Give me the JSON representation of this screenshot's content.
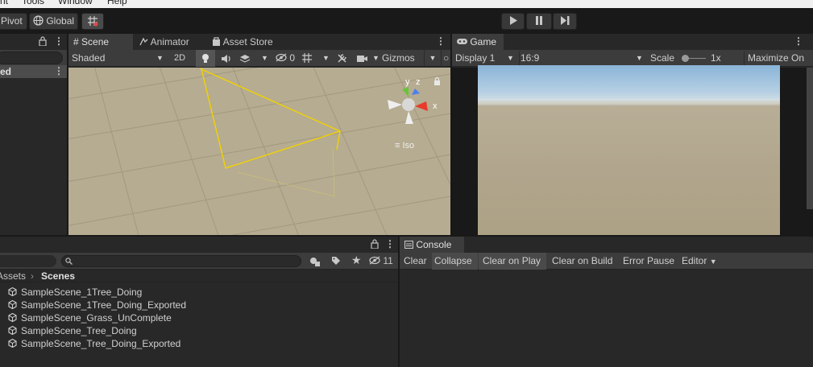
{
  "menu": {
    "items": [
      "nt",
      "Tools",
      "Window",
      "Help"
    ]
  },
  "toolbar": {
    "pivot_label": "Pivot",
    "global_label": "Global",
    "play_icon": "play-icon",
    "pause_icon": "pause-icon",
    "step_icon": "step-icon"
  },
  "hierarchy": {
    "row_label": "ed"
  },
  "scene_tabs": {
    "tabs": [
      {
        "label": "Scene",
        "icon": "grid-icon"
      },
      {
        "label": "Animator",
        "icon": "animator-icon"
      },
      {
        "label": "Asset Store",
        "icon": "store-icon"
      }
    ],
    "toolbar": {
      "shading_mode": "Shaded",
      "mode_2d": "2D",
      "hidden_count": "0",
      "gizmos_label": "Gizmos",
      "gizmo_y": "y",
      "gizmo_z": "z",
      "gizmo_x": "x",
      "projection_label": "Iso"
    }
  },
  "game": {
    "tab_label": "Game",
    "display": "Display 1",
    "aspect": "16:9",
    "scale_label": "Scale",
    "scale_value": "1x",
    "maximize_label": "Maximize On"
  },
  "project": {
    "hidden_count": "11",
    "breadcrumb": [
      "Assets",
      "Scenes"
    ],
    "files": [
      "SampleScene_1Tree_Doing",
      "SampleScene_1Tree_Doing_Exported",
      "SampleScene_Grass_UnComplete",
      "SampleScene_Tree_Doing",
      "SampleScene_Tree_Doing_Exported"
    ]
  },
  "console": {
    "tab_label": "Console",
    "buttons": [
      "Clear",
      "Collapse",
      "Clear on Play",
      "Clear on Build",
      "Error Pause",
      "Editor"
    ]
  },
  "colors": {
    "accent": "#3a72b0",
    "background": "#191919",
    "panel": "#282828",
    "sky": "#b7cde0",
    "ground": "#b5aa90"
  }
}
